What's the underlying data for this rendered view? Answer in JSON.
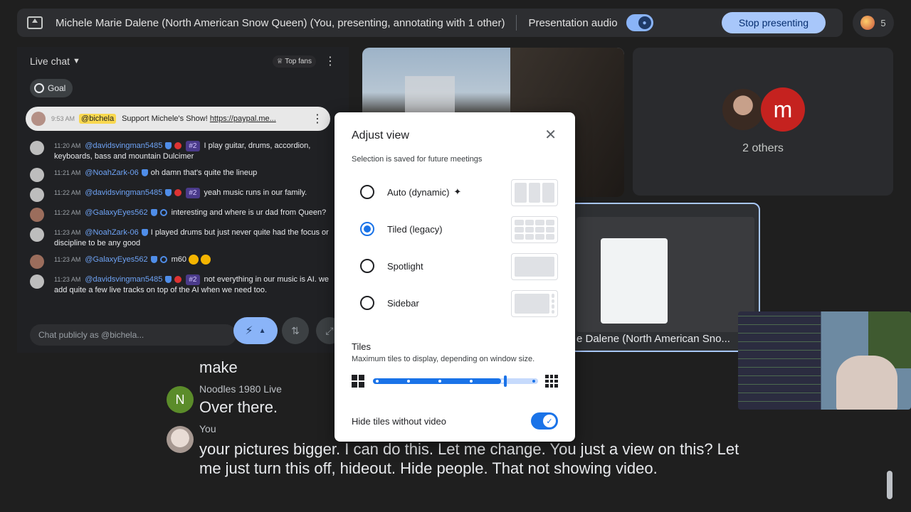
{
  "topbar": {
    "presenter_title": "Michele Marie Dalene (North American Snow Queen) (You, presenting, annotating with 1 other)",
    "audio_label": "Presentation audio",
    "stop_label": "Stop presenting",
    "people_count": "5"
  },
  "chat": {
    "header_label": "Live chat",
    "top_fans_label": "Top fans",
    "goal_label": "Goal",
    "pinned": {
      "time": "9:53 AM",
      "user": "@bichela",
      "text": "Support Michele's Show! ",
      "link": "https://paypal.me..."
    },
    "messages": [
      {
        "time": "11:20 AM",
        "user": "@davidsvingman5485",
        "rank": "#2",
        "text": "I play guitar, drums, accordion, keyboards, bass and mountain Dulcimer"
      },
      {
        "time": "11:21 AM",
        "user": "@NoahZark-06",
        "rank": "",
        "text": "oh damn that's quite the lineup"
      },
      {
        "time": "11:22 AM",
        "user": "@davidsvingman5485",
        "rank": "#2",
        "text": "yeah music runs in our family."
      },
      {
        "time": "11:22 AM",
        "user": "@GalaxyEyes562",
        "rank": "",
        "text": "interesting and where is ur dad from Queen?"
      },
      {
        "time": "11:23 AM",
        "user": "@NoahZark-06",
        "rank": "",
        "text": "I played drums but just never quite had the focus or discipline to be any good"
      },
      {
        "time": "11:23 AM",
        "user": "@GalaxyEyes562",
        "rank": "",
        "text": "m60"
      },
      {
        "time": "11:23 AM",
        "user": "@davidsvingman5485",
        "rank": "#2",
        "text": "not everything in our music is AI. we add quite a few live tracks on top of the AI when we need too."
      }
    ],
    "input_placeholder": "Chat publicly as @bichela..."
  },
  "tiles": {
    "others_label": "2 others",
    "others_avatar_letter": "m",
    "screen_name": "e Dalene (North American Sno..."
  },
  "captions": {
    "line1": "make",
    "speaker2": "Noodles 1980 Live",
    "speaker2_initial": "N",
    "line2": "Over there.",
    "speaker3": "You",
    "line3": "your pictures bigger. I can do this. Let me change. You just a view on this? Let me just turn this off, hideout. Hide people. That not showing video."
  },
  "modal": {
    "title": "Adjust view",
    "subtitle": "Selection is saved for future meetings",
    "options": [
      {
        "label": "Auto (dynamic)",
        "selected": false
      },
      {
        "label": "Tiled (legacy)",
        "selected": true
      },
      {
        "label": "Spotlight",
        "selected": false
      },
      {
        "label": "Sidebar",
        "selected": false
      }
    ],
    "tiles_title": "Tiles",
    "tiles_sub": "Maximum tiles to display, depending on window size.",
    "tiles_slider_fraction": 0.8,
    "hide_label": "Hide tiles without video",
    "hide_enabled": true
  },
  "colors": {
    "accent": "#1a73e8",
    "stop_button": "#a8c7fa",
    "background": "#1f1f1f"
  }
}
